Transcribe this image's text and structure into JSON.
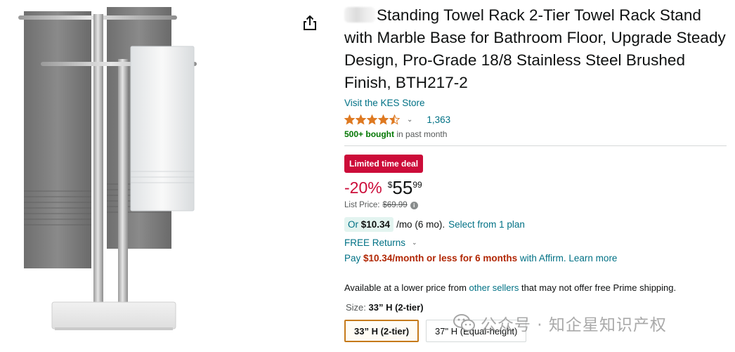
{
  "product": {
    "title": "Standing Towel Rack 2-Tier Towel Rack Stand with Marble Base for Bathroom Floor, Upgrade Steady Design, Pro-Grade 18/8 Stainless Steel Brushed Finish, BTH217-2",
    "store_link": "Visit the KES Store",
    "rating": 4.5,
    "rating_count": "1,363",
    "bought_bold": "500+ bought",
    "bought_rest": " in past month"
  },
  "deal": {
    "badge": "Limited time deal",
    "discount": "-20%",
    "currency": "$",
    "price_whole": "55",
    "price_fraction": "99",
    "list_price_label": "List Price:",
    "list_price_value": "$69.99"
  },
  "financing": {
    "or_text": "Or",
    "monthly_amount": "$10.34",
    "monthly_suffix": "/mo (6 mo).",
    "select_plan": "Select from 1 plan",
    "free_returns": "FREE Returns",
    "affirm_pay": "Pay",
    "affirm_bold": "$10.34/month or less for 6 months",
    "affirm_with": "with Affirm.",
    "affirm_learn": "Learn more"
  },
  "availability": {
    "text_before": "Available at a lower price from",
    "link": "other sellers",
    "text_after": "that may not offer free Prime shipping."
  },
  "size": {
    "label": "Size:",
    "selected": "33” H (2-tier)",
    "options": [
      "33” H (2-tier)",
      "37\" H (Equal-height)"
    ]
  },
  "watermark": {
    "text": "公众号 · 知企星知识产权"
  },
  "icons": {
    "share": "share-icon",
    "star": "star-icon",
    "info": "info-icon",
    "caret": "chevron-down-icon"
  },
  "colors": {
    "link": "#007185",
    "deal_red": "#cc0c39",
    "star_orange": "#de7921",
    "prime_green": "#007600",
    "selected_border": "#c57a1b"
  }
}
